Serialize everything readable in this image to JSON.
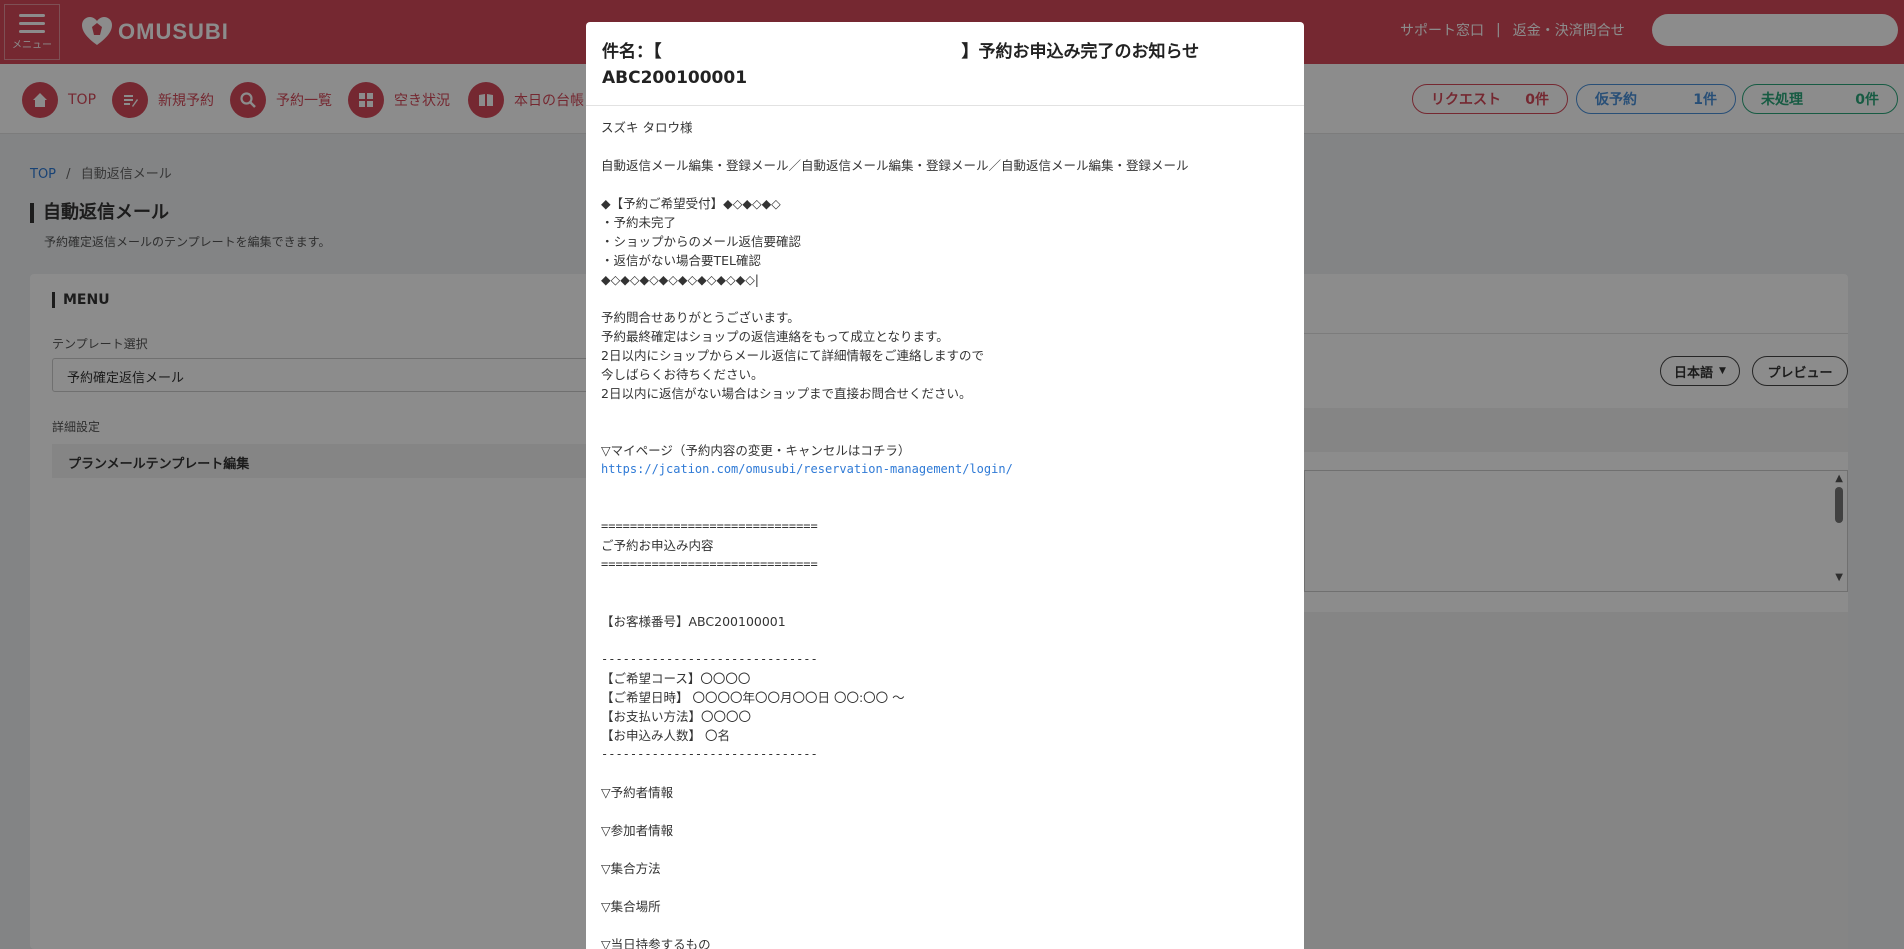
{
  "header": {
    "menu_label": "メニュー",
    "logo_text": "OMUSUBI",
    "support_link": "サポート窓口",
    "separator": "|",
    "refund_link": "返金・決済問合せ",
    "search_placeholder": ""
  },
  "nav": {
    "items": [
      {
        "label": "TOP",
        "icon": "home-icon"
      },
      {
        "label": "新規予約",
        "icon": "edit-icon"
      },
      {
        "label": "予約一覧",
        "icon": "search-icon"
      },
      {
        "label": "空き状況",
        "icon": "grid-icon"
      },
      {
        "label": "本日の台帳",
        "icon": "book-icon"
      }
    ],
    "pills": {
      "request_label": "リクエスト",
      "request_count": "0件",
      "kari_label": "仮予約",
      "kari_count": "1件",
      "mi_label": "未処理",
      "mi_count": "0件"
    }
  },
  "breadcrumb": {
    "top": "TOP",
    "sep": "/",
    "current": "自動返信メール"
  },
  "page": {
    "title": "自動返信メール",
    "subtitle": "予約確定返信メールのテンプレートを編集できます。"
  },
  "menu_panel": {
    "heading": "MENU",
    "template_label": "テンプレート選択",
    "template_value": "予約確定返信メール",
    "detail_label": "詳細設定",
    "plan_edit": "プランメールテンプレート編集"
  },
  "right_panel": {
    "lang_label": "日本語",
    "preview_label": "プレビュー"
  },
  "modal": {
    "subject_prefix": "件名：【",
    "subject_suffix": "】予約お申込み完了のお知らせ",
    "subject_code": "ABC200100001",
    "body": {
      "greeting": "スズキ タロウ様",
      "intro": "自動返信メール編集・登録メール／自動返信メール編集・登録メール／自動返信メール編集・登録メール",
      "notice_head": "◆【予約ご希望受付】◆◇◆◇◆◇",
      "notice_1": "・予約未完了",
      "notice_2": "・ショップからのメール返信要確認",
      "notice_3": "・返信がない場合要TEL確認",
      "notice_end": "◆◇◆◇◆◇◆◇◆◇◆◇◆◇◆◇|",
      "p1": "予約問合せありがとうございます。",
      "p2": "予約最終確定はショップの返信連絡をもって成立となります。",
      "p3": "2日以内にショップからメール返信にて詳細情報をご連絡しますので",
      "p4": "今しばらくお待ちください。",
      "p5": "2日以内に返信がない場合はショップまで直接お問合せください。",
      "mypage_label": "▽マイページ（予約内容の変更・キャンセルはコチラ）",
      "mypage_url": "https://jcation.com/omusubi/reservation-management/login/",
      "eq_line": "==============================",
      "section_title": "ご予約お申込み内容",
      "customer_no": "【お客様番号】ABC200100001",
      "dash_line": "------------------------------",
      "course": "【ご希望コース】〇〇〇〇",
      "datetime": "【ご希望日時】 〇〇〇〇年〇〇月〇〇日 〇〇:〇〇 ～",
      "payment": "【お支払い方法】〇〇〇〇",
      "people": "【お申込み人数】 〇名",
      "booker": "▽予約者情報",
      "participant": "▽参加者情報",
      "meeting_method": "▽集合方法",
      "meeting_place": "▽集合場所",
      "bring_items": "▽当日持参するもの"
    }
  }
}
